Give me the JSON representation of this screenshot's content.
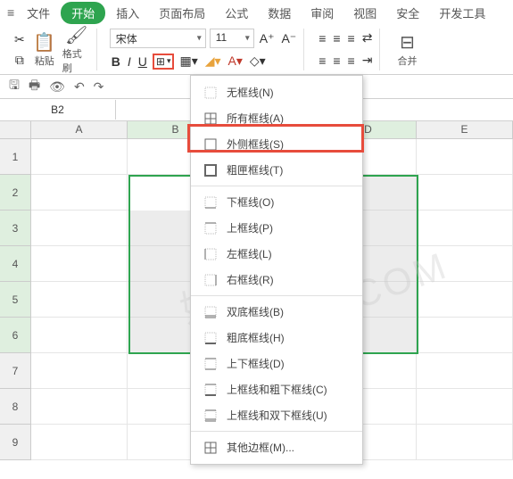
{
  "menubar": {
    "items": [
      "文件",
      "开始",
      "插入",
      "页面布局",
      "公式",
      "数据",
      "审阅",
      "视图",
      "安全",
      "开发工具"
    ],
    "active_index": 1
  },
  "toolbar": {
    "paste_label": "粘贴",
    "format_painter_label": "格式刷",
    "font_name": "宋体",
    "font_size": "11",
    "merge_label": "合并"
  },
  "formula": {
    "cell_ref": "B2"
  },
  "columns": [
    "A",
    "B",
    "C",
    "D",
    "E"
  ],
  "rows": [
    "1",
    "2",
    "3",
    "4",
    "5",
    "6",
    "7",
    "8",
    "9"
  ],
  "selected_cols": [
    1,
    2,
    3
  ],
  "selected_rows": [
    1,
    2,
    3,
    4,
    5
  ],
  "border_menu": {
    "groups": [
      [
        {
          "icon": "none",
          "label": "无框线(N)"
        },
        {
          "icon": "all",
          "label": "所有框线(A)"
        },
        {
          "icon": "outer",
          "label": "外侧框线(S)"
        },
        {
          "icon": "thick",
          "label": "粗匣框线(T)"
        }
      ],
      [
        {
          "icon": "bottom",
          "label": "下框线(O)"
        },
        {
          "icon": "top",
          "label": "上框线(P)"
        },
        {
          "icon": "left",
          "label": "左框线(L)"
        },
        {
          "icon": "right",
          "label": "右框线(R)"
        }
      ],
      [
        {
          "icon": "dbl-bottom",
          "label": "双底框线(B)"
        },
        {
          "icon": "thick-bottom",
          "label": "粗底框线(H)"
        },
        {
          "icon": "top-bottom",
          "label": "上下框线(D)"
        },
        {
          "icon": "top-thick-bottom",
          "label": "上框线和粗下框线(C)"
        },
        {
          "icon": "top-dbl-bottom",
          "label": "上框线和双下框线(U)"
        }
      ],
      [
        {
          "icon": "more",
          "label": "其他边框(M)..."
        }
      ]
    ],
    "highlighted_index": 2
  },
  "watermark": "好友学网\nHYXXW.COM"
}
